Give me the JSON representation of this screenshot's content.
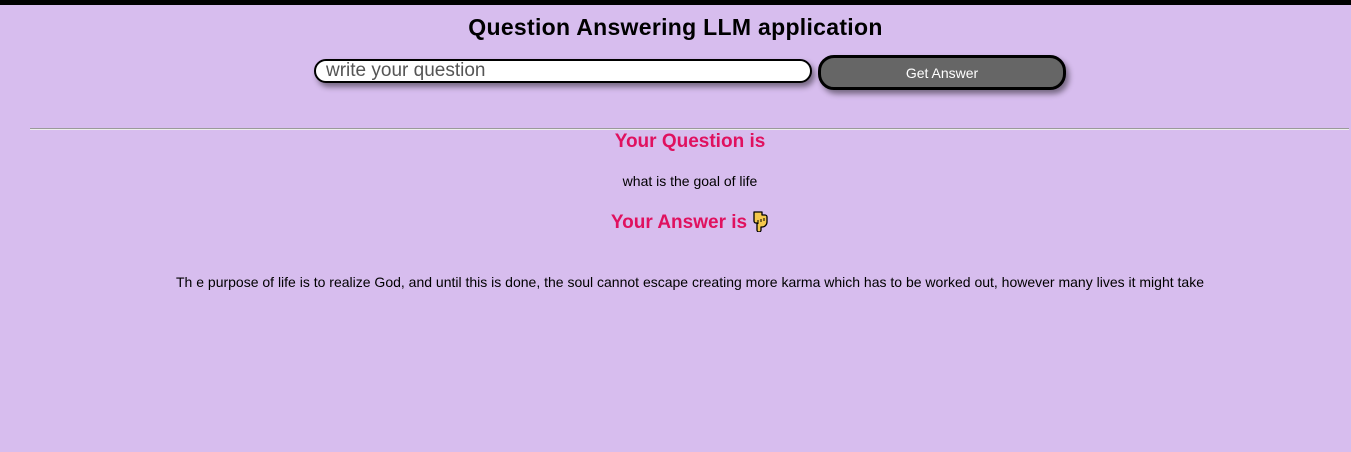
{
  "app": {
    "title": "Question Answering LLM application"
  },
  "form": {
    "input_placeholder": "write your question",
    "input_value": "",
    "button_label": "Get Answer"
  },
  "result": {
    "question_heading": "Your Question is",
    "question_text": "what is the goal of life",
    "answer_heading": "Your Answer is",
    "answer_icon": "pointing-down-hand-icon",
    "answer_text": "Th e purpose of life is to realize God, and until this is done, the soul cannot escape creating more karma which has to be worked out, however many lives it might take"
  },
  "colors": {
    "background": "#d7bdee",
    "heading_accent": "#e0115f",
    "button_background": "#666666"
  }
}
